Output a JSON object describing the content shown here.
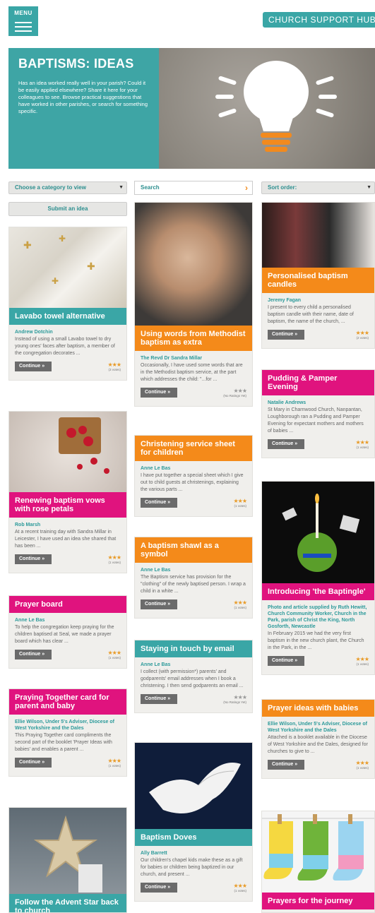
{
  "header": {
    "menu_label": "MENU",
    "hub_label": "CHURCH SUPPORT HUB"
  },
  "hero": {
    "title": "BAPTISMS: IDEAS",
    "text": "Has an idea worked really well in your parish? Could it be easily applied elsewhere? Share it here for your colleagues to see. Browse practical suggestions that have worked in other parishes, or search for something specific."
  },
  "controls": {
    "category_label": "Choose a category to view",
    "search_label": "Search",
    "sort_label": "Sort order:",
    "submit_label": "Submit an idea"
  },
  "continue_label": "Continue »",
  "cards": [
    {
      "title": "Lavabo towel alternative",
      "author": "Andrew Dotchin",
      "desc": "Instead of using a small Lavabo towel to dry young ones' faces after baptism, a member of the congregation decorates ...",
      "votes": "(3 votes)",
      "rating": 3
    },
    {
      "title": "Renewing baptism vows with rose petals",
      "author": "Rob Marsh",
      "desc": "At a recent training day with Sandra Millar in Leicester, I have used an idea she shared that has been ...",
      "votes": "(1 votes)",
      "rating": 3
    },
    {
      "title": "Prayer board",
      "author": "Anne Le Bas",
      "desc": "To help the congregation keep praying for the children baptised at Seal, we made a prayer board which has clear ...",
      "votes": "(1 votes)",
      "rating": 3
    },
    {
      "title": "Praying Together card for parent and baby",
      "author": "Ellie Wilson, Under 5's Adviser, Diocese of West Yorkshire and the Dales",
      "desc": "This Praying Together card compliments the second part of the booklet 'Prayer Ideas with babies' and enables a parent ...",
      "votes": "(1 votes)",
      "rating": 3
    },
    {
      "title": "Follow the Advent Star back to church"
    },
    {
      "title": "Using words from Methodist baptism as extra",
      "author": "The Revd Dr Sandra Millar",
      "desc": "Occasionally, I have used some words that are in the Methodist baptism service, at the part which addresses the child: \"...for ...",
      "votes": "(No Ratings Yet)",
      "rating": 0
    },
    {
      "title": "Christening service sheet for children",
      "author": "Anne Le Bas",
      "desc": "I have put together a special sheet which I give out to child guests at christenings, explaining the various parts ...",
      "votes": "(1 votes)",
      "rating": 3
    },
    {
      "title": "A baptism shawl as a symbol",
      "author": "Anne Le Bas",
      "desc": "The Baptism service has provision for the \"clothing\" of the newly baptised person. I wrap a child in a white ...",
      "votes": "(1 votes)",
      "rating": 3
    },
    {
      "title": "Staying in touch by email",
      "author": "Anne Le Bas",
      "desc": "I collect (with permission*) parents' and godparents' email addresses when I book a christening. I then send godparents an email ...",
      "votes": "(No Ratings Yet)",
      "rating": 0
    },
    {
      "title": "Baptism Doves",
      "author": "Ally Barrett",
      "desc": "Our children's chapel kids make these as a gift for babies or children being baptized in our church, and present ...",
      "votes": "(1 votes)",
      "rating": 3
    },
    {
      "title": "Personalised baptism candles",
      "author": "Jeremy Fagan",
      "desc": "I present to every child a personalised baptism candle with their name, date of baptism, the name of the church, ...",
      "votes": "(2 votes)",
      "rating": 3
    },
    {
      "title": "Pudding & Pamper Evening",
      "author": "Natalie Andrews",
      "desc": "St Mary in Charnwood Church, Nanpantan, Loughborough ran a Pudding and Pamper Evening for expectant mothers and mothers of babies ...",
      "votes": "(1 votes)",
      "rating": 3
    },
    {
      "title": "Introducing 'the Baptingle'",
      "author": "Photo and article supplied by Ruth Hewitt, Church Community Worker, Church in the Park, parish of Christ the King, North Gosforth, Newcastle",
      "desc": "In February 2015 we had the very first baptism in the new church plant, the Church in the Park, in the ...",
      "votes": "(1 votes)",
      "rating": 3
    },
    {
      "title": "Prayer ideas with babies",
      "author": "Ellie Wilson, Under 5's Adviser, Diocese of West Yorkshire and the Dales",
      "desc": "Attached is a booklet available in the Diocese of West Yorkshire and the Dales, designed for churches to give to ...",
      "votes": "(1 votes)",
      "rating": 3
    },
    {
      "title": "Prayers for the journey"
    }
  ]
}
